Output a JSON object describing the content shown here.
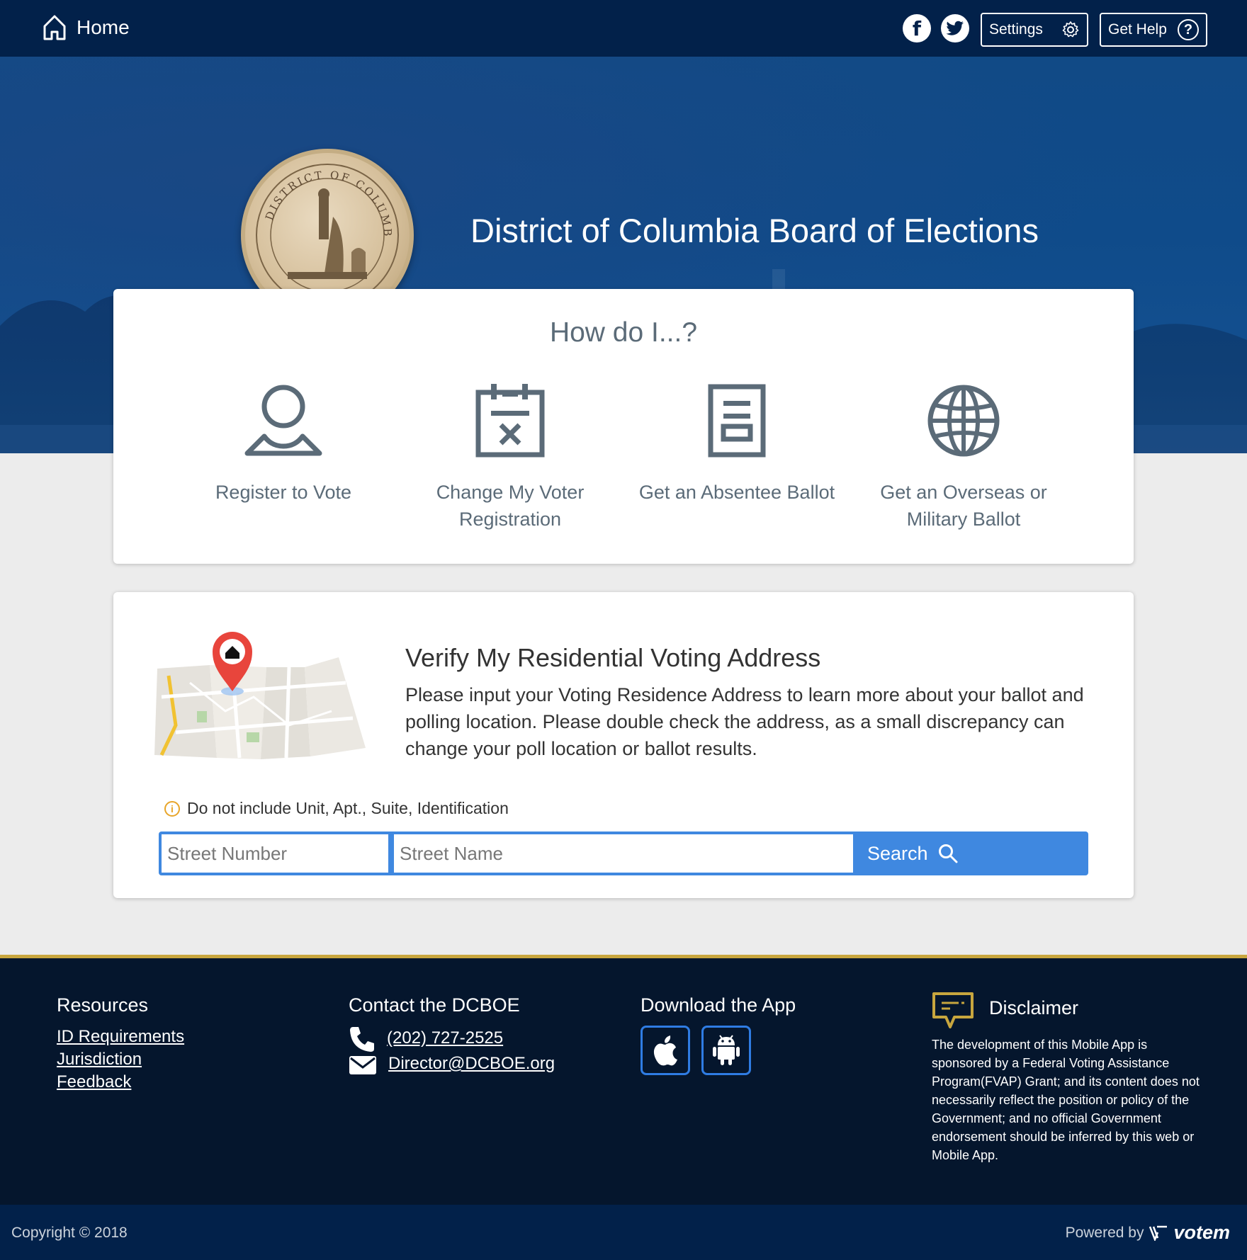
{
  "nav": {
    "home_label": "Home",
    "settings_label": "Settings",
    "help_label": "Get Help"
  },
  "hero": {
    "title": "District of Columbia Board of Elections",
    "seal_text": "DISTRICT OF COLUMBIA"
  },
  "howdo": {
    "title": "How do I...?",
    "items": [
      {
        "label": "Register to Vote",
        "icon": "person-icon"
      },
      {
        "label": "Change My Voter Registration",
        "icon": "calendar-x-icon"
      },
      {
        "label": "Get an Absentee Ballot",
        "icon": "document-icon"
      },
      {
        "label": "Get an Overseas or Military Ballot",
        "icon": "globe-icon"
      }
    ]
  },
  "verify": {
    "title": "Verify My Residential Voting Address",
    "description": "Please input your Voting Residence Address to learn more about your ballot and polling location. Please double check the address, as a small discrepancy can change your poll location or ballot results.",
    "hint": "Do not include Unit, Apt., Suite, Identification",
    "street_number_placeholder": "Street Number",
    "street_name_placeholder": "Street Name",
    "search_label": "Search"
  },
  "footer": {
    "resources_title": "Resources",
    "resources_links": [
      "ID Requirements",
      "Jurisdiction",
      "Feedback"
    ],
    "contact_title": "Contact the DCBOE",
    "phone": "(202) 727-2525",
    "email": "Director@DCBOE.org",
    "app_title": "Download the App",
    "disclaimer_title": "Disclaimer",
    "disclaimer_text": "The development of this Mobile App is sponsored by a Federal Voting Assistance Program(FVAP) Grant; and its content does not necessarily reflect the position or policy of the Government; and no official Government endorsement should be inferred by this web or Mobile App."
  },
  "bottom": {
    "copyright": "Copyright © 2018",
    "powered_by": "Powered by",
    "brand": "votem"
  },
  "colors": {
    "nav_bg": "#02214a",
    "hero_bg": "#114a86",
    "accent_blue": "#3f88e0",
    "footer_bg": "#05162d",
    "gold": "#c8a63e",
    "icon_gray": "#5b6b78"
  }
}
